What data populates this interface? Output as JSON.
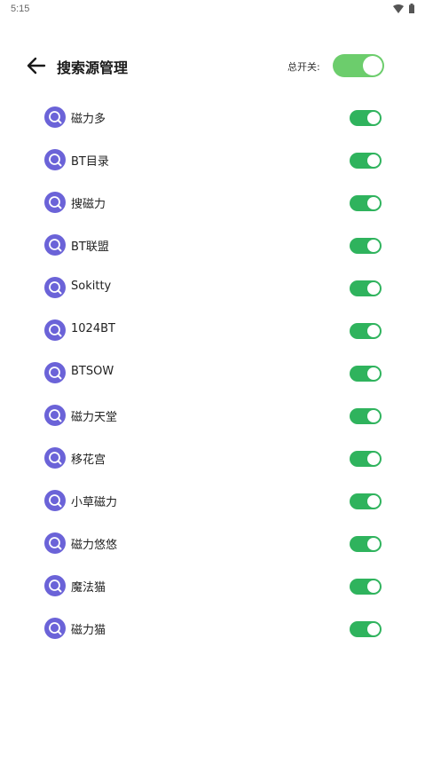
{
  "status_bar": {
    "time": "5:15"
  },
  "header": {
    "title": "搜索源管理",
    "master_switch_label": "总开关:",
    "master_switch_on": true
  },
  "colors": {
    "master_toggle": "#6ccd6c",
    "row_toggle": "#2fb35d",
    "source_icon": "#6b63d8"
  },
  "sources": [
    {
      "name": "磁力多",
      "enabled": true
    },
    {
      "name": "BT目录",
      "enabled": true
    },
    {
      "name": "搜磁力",
      "enabled": true
    },
    {
      "name": "BT联盟",
      "enabled": true
    },
    {
      "name": "Sokitty",
      "enabled": true
    },
    {
      "name": "1024BT",
      "enabled": true
    },
    {
      "name": "BTSOW",
      "enabled": true
    },
    {
      "name": "磁力天堂",
      "enabled": true
    },
    {
      "name": "移花宫",
      "enabled": true
    },
    {
      "name": "小草磁力",
      "enabled": true
    },
    {
      "name": "磁力悠悠",
      "enabled": true
    },
    {
      "name": "魔法猫",
      "enabled": true
    },
    {
      "name": "磁力猫",
      "enabled": true
    }
  ]
}
